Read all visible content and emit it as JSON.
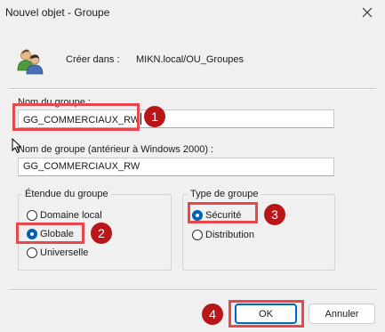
{
  "window": {
    "title": "Nouvel objet - Groupe",
    "close_icon": "close-icon"
  },
  "header": {
    "create_in_label": "Créer dans :",
    "create_in_value": "MIKN.local/OU_Groupes",
    "icon": "users-group-icon"
  },
  "form": {
    "group_name_label": "Nom du groupe :",
    "group_name_value": "GG_COMMERCIAUX_RW",
    "group_name_pre2000_label": "Nom de groupe (antérieur à Windows 2000) :",
    "group_name_pre2000_value": "GG_COMMERCIAUX_RW"
  },
  "scope": {
    "legend": "Étendue du groupe",
    "options": [
      {
        "label": "Domaine local",
        "checked": false
      },
      {
        "label": "Globale",
        "checked": true
      },
      {
        "label": "Universelle",
        "checked": false
      }
    ]
  },
  "type": {
    "legend": "Type de groupe",
    "options": [
      {
        "label": "Sécurité",
        "checked": true
      },
      {
        "label": "Distribution",
        "checked": false
      }
    ]
  },
  "buttons": {
    "ok": "OK",
    "cancel": "Annuler"
  },
  "annotations": {
    "badges": [
      "1",
      "2",
      "3",
      "4"
    ],
    "highlight_color": "#e8474c",
    "badge_color": "#b9161a"
  },
  "colors": {
    "accent": "#005fb8",
    "window_bg": "#f0f0f0"
  }
}
